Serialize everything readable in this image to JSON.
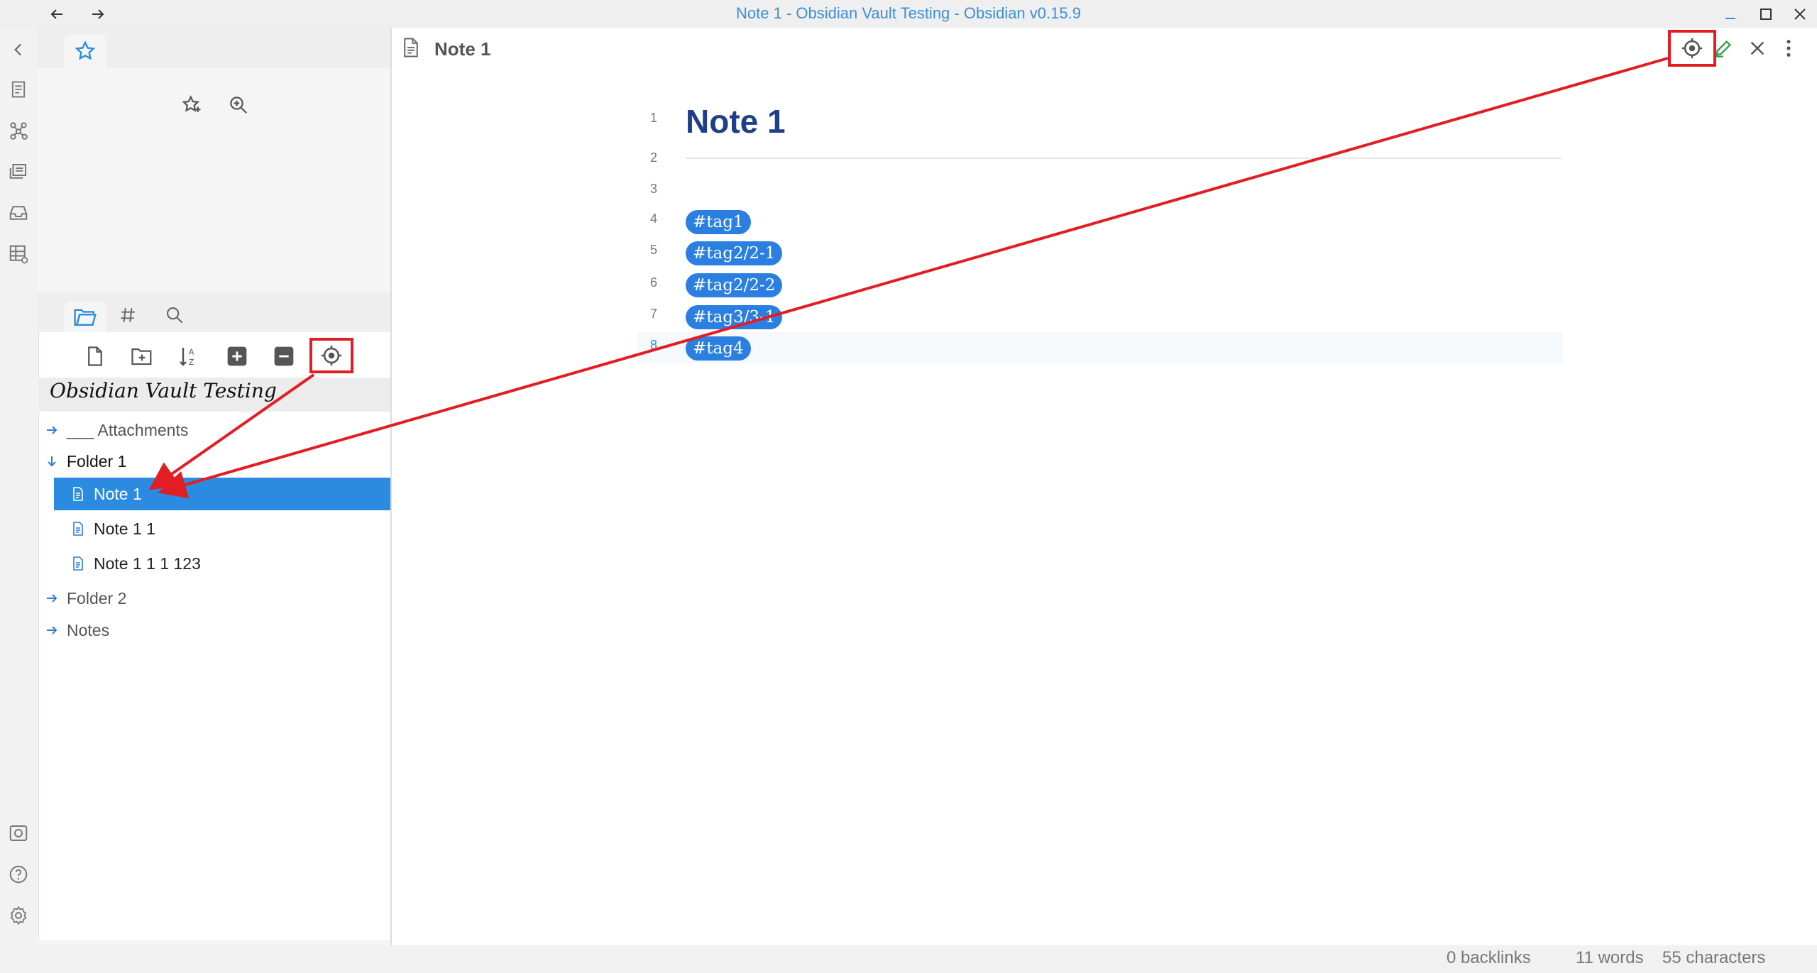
{
  "window": {
    "title": "Note 1 - Obsidian Vault Testing - Obsidian v0.15.9"
  },
  "explorer": {
    "vault_name": "Obsidian Vault Testing",
    "items": [
      {
        "label": "___ Attachments",
        "type": "folder",
        "state": "collapsed"
      },
      {
        "label": "Folder 1",
        "type": "folder",
        "state": "expanded"
      },
      {
        "label": "Note 1",
        "type": "file",
        "selected": true
      },
      {
        "label": "Note 1 1",
        "type": "file"
      },
      {
        "label": "Note 1 1 1 123",
        "type": "file"
      },
      {
        "label": "Folder 2",
        "type": "folder",
        "state": "collapsed"
      },
      {
        "label": "Notes",
        "type": "folder",
        "state": "collapsed"
      }
    ]
  },
  "editor": {
    "tab_title": "Note 1",
    "heading": "Note 1",
    "line_numbers": [
      "1",
      "2",
      "3",
      "4",
      "5",
      "6",
      "7",
      "8"
    ],
    "tags": [
      "#tag1",
      "#tag2/2-1",
      "#tag2/2-2",
      "#tag3/3-1",
      "#tag4"
    ]
  },
  "status": {
    "backlinks": "0 backlinks",
    "words": "11 words",
    "characters": "55 characters"
  },
  "colors": {
    "accent": "#2a8be0",
    "tag_bg": "#2a7fe0",
    "annotation": "#e21d24",
    "heading": "#1f3f8a",
    "title_text": "#3d8fd8"
  },
  "icons": {
    "titlebar": [
      "arrow-left-icon",
      "arrow-right-icon",
      "minimize-icon",
      "maximize-icon",
      "close-icon"
    ],
    "ribbon": [
      "collapse-icon",
      "file-icon",
      "graph-icon",
      "slides-icon",
      "inbox-icon",
      "table-icon",
      "vault-icon",
      "help-icon",
      "settings-icon"
    ],
    "explorer_toolbar": [
      "new-note-icon",
      "new-folder-icon",
      "sort-icon",
      "expand-all-icon",
      "collapse-all-icon",
      "reveal-active-file-icon"
    ],
    "editor_header": [
      "reveal-active-file-icon",
      "edit-pencil-icon",
      "close-icon",
      "more-options-icon"
    ]
  }
}
